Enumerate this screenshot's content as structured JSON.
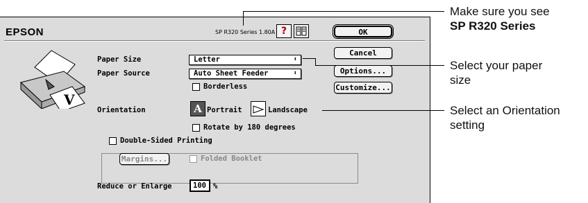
{
  "dialog": {
    "brand": "EPSON",
    "version": "SP R320 Series 1.80A",
    "help_icon_glyph": "?",
    "buttons": {
      "ok": "OK",
      "cancel": "Cancel",
      "options": "Options...",
      "customize": "Customize..."
    },
    "paper_size": {
      "label": "Paper Size",
      "value": "Letter"
    },
    "paper_source": {
      "label": "Paper Source",
      "value": "Auto Sheet Feeder"
    },
    "borderless": {
      "label": "Borderless",
      "checked": false
    },
    "orientation": {
      "label": "Orientation",
      "portrait": "Portrait",
      "landscape": "Landscape",
      "portrait_glyph": "A",
      "selected": "Portrait"
    },
    "rotate": {
      "label": "Rotate by 180 degrees",
      "checked": false
    },
    "double_sided": {
      "label": "Double-Sided Printing",
      "checked": false
    },
    "margins_button": "Margins...",
    "folded_booklet": {
      "label": "Folded Booklet",
      "checked": false
    },
    "reduce_enlarge": {
      "label": "Reduce or Enlarge",
      "value": "100",
      "unit": "%"
    },
    "printer_illustration_letter": "V"
  },
  "callouts": [
    {
      "line1": "Make sure you see",
      "line2": "SP R320 Series",
      "line2_bold": true
    },
    {
      "line1": "Select your paper",
      "line2": "size"
    },
    {
      "line1": "Select an Orientation",
      "line2": "setting"
    }
  ]
}
